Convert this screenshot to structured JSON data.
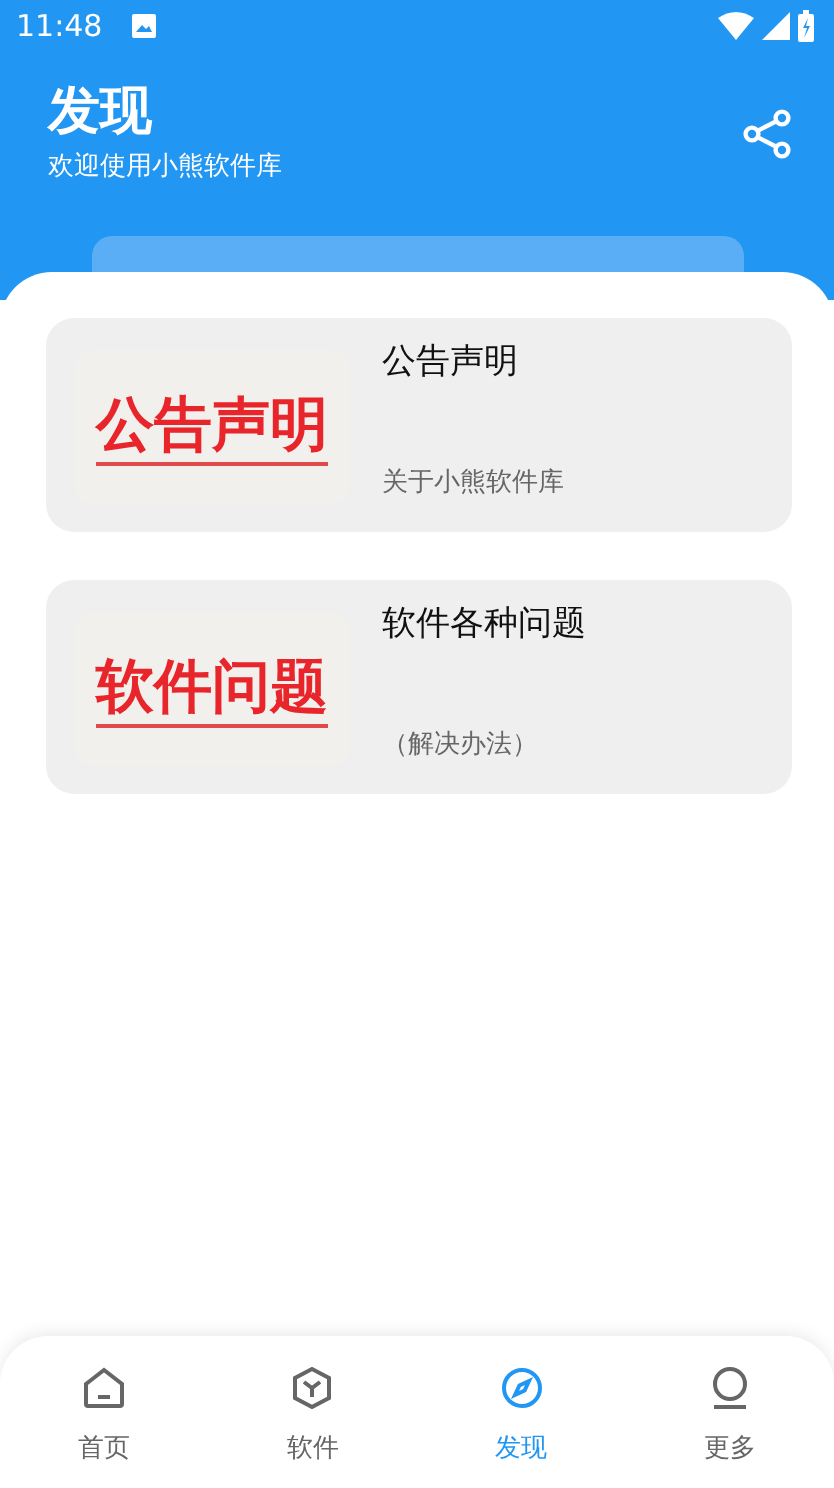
{
  "status_bar": {
    "time": "11:48"
  },
  "header": {
    "title": "发现",
    "subtitle": "欢迎使用小熊软件库"
  },
  "cards": [
    {
      "thumb_text": "公告声明",
      "title": "公告声明",
      "subtitle": "关于小熊软件库"
    },
    {
      "thumb_text": "软件问题",
      "title": "软件各种问题",
      "subtitle": "（解决办法）"
    }
  ],
  "nav": [
    {
      "label": "首页",
      "selected": false
    },
    {
      "label": "软件",
      "selected": false
    },
    {
      "label": "发现",
      "selected": true
    },
    {
      "label": "更多",
      "selected": false
    }
  ]
}
